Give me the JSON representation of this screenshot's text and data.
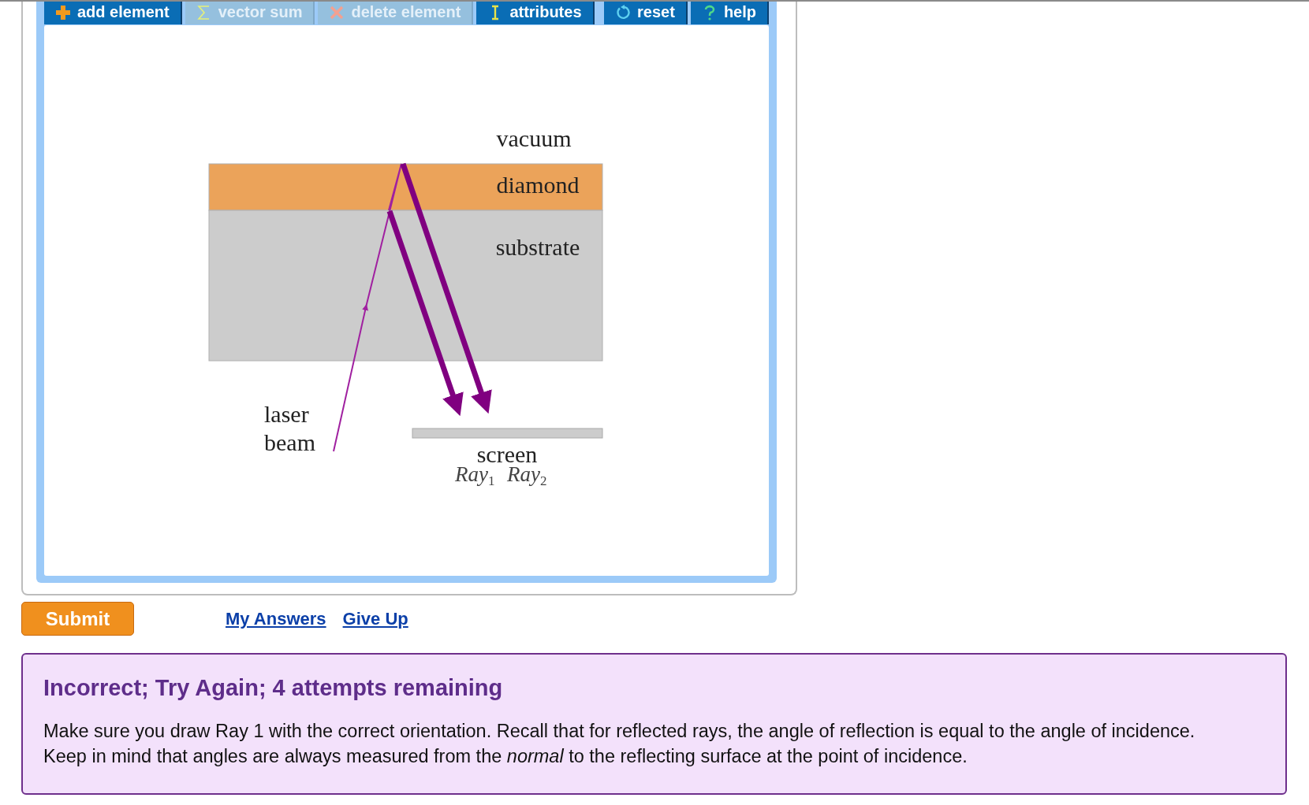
{
  "toolbar": [
    {
      "label": "add element",
      "kind": "plus",
      "disabled": false
    },
    {
      "label": "vector sum",
      "kind": "sigma",
      "disabled": true
    },
    {
      "label": "delete element",
      "kind": "cross",
      "disabled": true
    },
    {
      "label": "attributes",
      "kind": "ibeam",
      "disabled": false
    },
    {
      "label": "reset",
      "kind": "reset",
      "disabled": false
    },
    {
      "label": "help",
      "kind": "question",
      "disabled": false
    }
  ],
  "diagram": {
    "medium_label": "vacuum",
    "layers": [
      {
        "label": "diamond",
        "color": "#eba35a"
      },
      {
        "label": "substrate",
        "color": "#cccccc"
      }
    ],
    "beam_label": [
      "laser",
      "beam"
    ],
    "screen_label": "screen",
    "ray_labels": [
      {
        "name": "Ray",
        "index": "1"
      },
      {
        "name": "Ray",
        "index": "2"
      }
    ]
  },
  "submit": "Submit",
  "links": [
    "My Answers",
    "Give Up"
  ],
  "feedback": {
    "title": "Incorrect; Try Again; 4 attempts remaining",
    "text": "Make sure you draw Ray 1 with the correct orientation. Recall that for reflected rays, the angle of reflection is equal to the angle of incidence. Keep in mind that angles are always measured from the *normal* to the reflecting surface at the point of incidence."
  }
}
